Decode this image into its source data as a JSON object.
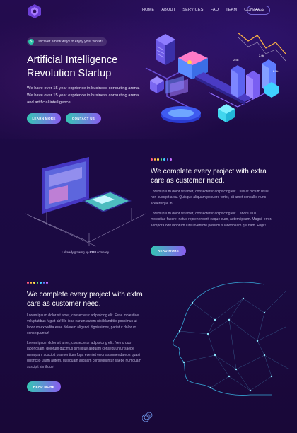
{
  "nav": {
    "items": [
      "HOME",
      "ABOUT",
      "SERVICES",
      "FAQ",
      "TEAM",
      "CONTACT"
    ],
    "login": "LOG IN"
  },
  "hero": {
    "pill": "Discover a new ways to enjoy your World!",
    "pill_icon": "$",
    "title_line1": "Artificial Intelligence",
    "title_line2": "Revolution Startup",
    "lead": "We have over 15 year exprience in business consulting arena. We have over 15 year exprience in business consulting arena and artificial intelligence.",
    "btn_learn": "LEARN MORE",
    "btn_contact": "CONTACT US",
    "chart_labels": [
      "2.5k",
      "2.0k",
      "2.5k"
    ]
  },
  "section1": {
    "title": "We complete every project with extra care as customer need.",
    "p1": "Lorem ipsum dolor sit amet, consectetur adipiscing elit. Duis at dictum risus, non suscipit arcu. Quisque aliquam posuere tortor, sit amet convallis nunc scelerisque in.",
    "p2": "Lorem ipsum dolor sit amet, consectetur adipiscing elit. Labore eius molestiae facere, natus reprehenderit eaque eum, autem ipsam. Magni, error. Tempora odit laborum iure inventore possimus laboriosam qui nam. Fugit!",
    "btn": "READ MORE",
    "note_pre": "* Already growing up",
    "note_num": "9338",
    "note_post": "company"
  },
  "section2": {
    "title": "We complete every project with extra care as customer need.",
    "p1": "Lorem ipsum dolor sit amet, consectetur adipisicing elit. Esse molestiae voluptatibus fugiat ab! Illo ipsa earum autem nisi blanditiis possimus ut laborum expedita esse dolorem aligendi dignissimos, pariatur dolorum consequuntur!",
    "p2": "Lorem ipsum dolor sit amet, consectetur adipisicing elit. Nemo quo laboriosam, dolorum ducimus similique aliquam consequuntur saepe numquam suscipit praesentium fuga eveniet error assumenda eos quasi distinctio ullam autem, quisquam aliquam consequuntur saepe numquam suscipit similique!",
    "btn": "READ MORE"
  },
  "colors": {
    "accent_teal": "#35c6b4",
    "accent_purple": "#8a5cf0",
    "dot_colors": [
      "#ff5b7a",
      "#ffb545",
      "#ffe14a",
      "#5ee87a",
      "#3fd0ff",
      "#5b7bff",
      "#c36bff"
    ]
  }
}
